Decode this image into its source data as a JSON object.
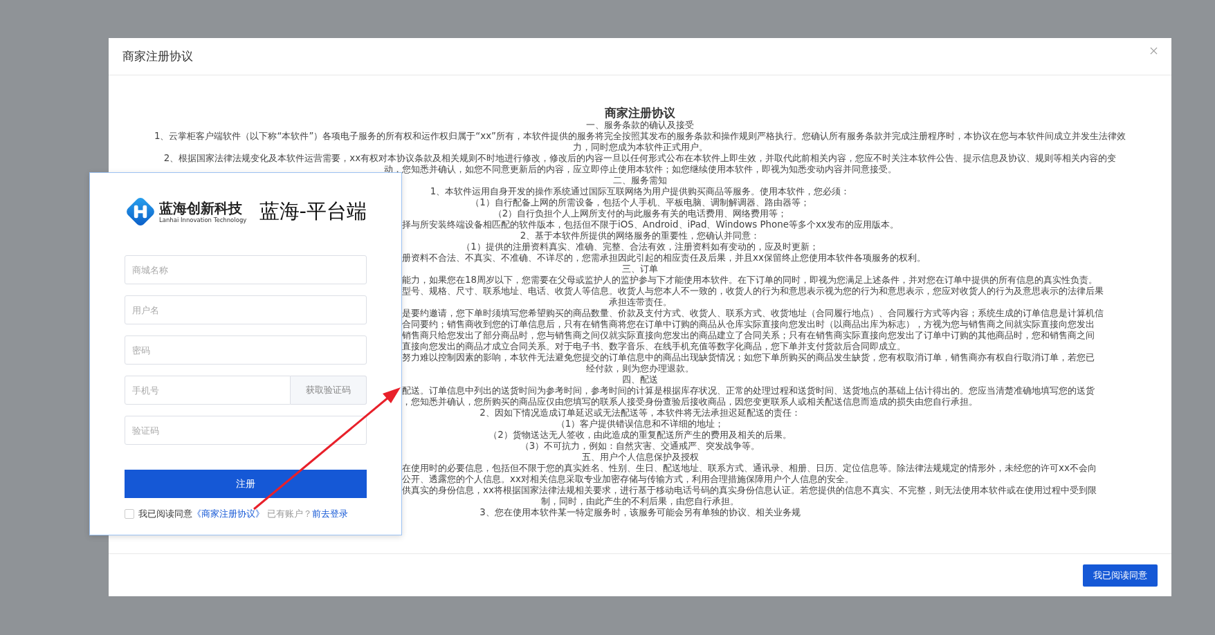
{
  "modal": {
    "title": "商家注册协议",
    "document": {
      "title": "商家注册协议",
      "lines": [
        {
          "kind": "center",
          "text": "一、服务条款的确认及接受"
        },
        {
          "kind": "center",
          "text": "1、云掌柜客户端软件（以下称“本软件”）各项电子服务的所有权和运作权归属于“xx”所有，本软件提供的服务将完全按照其发布的服务条款和操作规则严格执行。您确认所有服务条款并完成注册程序时，本协议在您与本软件间成立并发生法律效"
        },
        {
          "kind": "center",
          "text": "力，同时您成为本软件正式用户。"
        },
        {
          "kind": "center",
          "text": "2、根据国家法律法规变化及本软件运营需要，xx有权对本协议条款及相关规则不时地进行修改，修改后的内容一旦以任何形式公布在本软件上即生效，并取代此前相关内容，您应不时关注本软件公告、提示信息及协议、规则等相关内容的变"
        },
        {
          "kind": "center",
          "text": "动，您知悉并确认，如您不同意更新后的内容，应立即停止使用本软件；如您继续使用本软件，即视为知悉变动内容并同意接受。"
        },
        {
          "kind": "center",
          "text": "二、服务需知"
        },
        {
          "kind": "center",
          "text": "1、本软件运用自身开发的操作系统通过国际互联网络为用户提供购买商品等服务。使用本软件，您必须："
        },
        {
          "kind": "center",
          "text": "（1）自行配备上网的所需设备，包括个人手机、平板电脑、调制解调器、路由器等；"
        },
        {
          "kind": "center",
          "text": "（2）自行负担个人上网所支付的与此服务有关的电话费用、网络费用等；"
        },
        {
          "kind": "cut",
          "text": "择与所安装终端设备相匹配的软件版本，包括但不限于iOS、Android、iPad、Windows Phone等多个xx发布的应用版本。"
        },
        {
          "kind": "center",
          "text": "2、基于本软件所提供的网络服务的重要性，您确认并同意："
        },
        {
          "kind": "center",
          "text": "（1）提供的注册资料真实、准确、完整、合法有效，注册资料如有变动的，应及时更新；"
        },
        {
          "kind": "cut",
          "text": "册资料不合法、不真实、不准确、不详尽的，您需承担因此引起的相应责任及后果，并且xx保留终止您使用本软件各项服务的权利。"
        },
        {
          "kind": "center",
          "text": "三、订单"
        },
        {
          "kind": "cut",
          "text": "能力，如果您在18周岁以下，您需要在父母或监护人的监护参与下才能使用本软件。在下订单的同时，即视为您满足上述条件，并对您在订单中提供的所有信息的真实性负责。"
        },
        {
          "kind": "cut",
          "text": "型号、规格、尺寸、联系地址、电话、收货人等信息。收货人与您本人不一致的，收货人的行为和意思表示视为您的行为和意思表示，您应对收货人的行为及意思表示的法律后果"
        },
        {
          "kind": "center",
          "text": "承担连带责任。"
        },
        {
          "kind": "cut",
          "text": "是要约邀请，您下单时须填写您希望购买的商品数量、价款及支付方式、收货人、联系方式、收货地址（合同履行地点）、合同履行方式等内容；系统生成的订单信息是计算机信"
        },
        {
          "kind": "cut",
          "text": "合同要约；销售商收到您的订单信息后，只有在销售商将您在订单中订购的商品从仓库实际直接向您发出时（以商品出库为标志），方视为您与销售商之间就实际直接向您发出"
        },
        {
          "kind": "cut",
          "text": "销售商只给您发出了部分商品时，您与销售商之间仅就实际直接向您发出的商品建立了合同关系；只有在销售商实际直接向您发出了订单中订购的其他商品时，您和销售商之间"
        },
        {
          "kind": "cut",
          "text": "直接向您发出的商品才成立合同关系。对于电子书、数字音乐、在线手机充值等数字化商品，您下单并支付货款后合同即成立。"
        },
        {
          "kind": "cut",
          "text": "努力难以控制因素的影响，本软件无法避免您提交的订单信息中的商品出现缺货情况；如您下单所购买的商品发生缺货，您有权取消订单，销售商亦有权自行取消订单，若您已"
        },
        {
          "kind": "center",
          "text": "经付款，则为您办理退款。"
        },
        {
          "kind": "center",
          "text": "四、配送"
        },
        {
          "kind": "cut",
          "text": "配送。订单信息中列出的送货时间为参考时间，参考时间的计算是根据库存状况、正常的处理过程和送货时间、送货地点的基础上估计得出的。您应当清楚准确地填写您的送货"
        },
        {
          "kind": "cut",
          "text": "，您知悉并确认，您所购买的商品应仅由您填写的联系人接受身份查验后接收商品，因您变更联系人或相关配送信息而造成的损失由您自行承担。"
        },
        {
          "kind": "center",
          "text": "2、因如下情况造成订单延迟或无法配送等，本软件将无法承担迟延配送的责任："
        },
        {
          "kind": "center",
          "text": "（1）客户提供错误信息和不详细的地址；"
        },
        {
          "kind": "center",
          "text": "（2）货物送达无人签收，由此造成的重复配送所产生的费用及相关的后果。"
        },
        {
          "kind": "center",
          "text": "（3）不可抗力，例如：自然灾害、交通戒严、突发战争等。"
        },
        {
          "kind": "center",
          "text": "五、用户个人信息保护及授权"
        },
        {
          "kind": "cut",
          "text": "在使用时的必要信息，包括但不限于您的真实姓名、性别、生日、配送地址、联系方式、通讯录、相册、日历、定位信息等。除法律法规规定的情形外，未经您的许可xx不会向"
        },
        {
          "kind": "cut",
          "text": "公开、透露您的个人信息。xx对相关信息采取专业加密存储与传输方式，利用合理措施保障用户个人信息的安全。"
        },
        {
          "kind": "cut",
          "text": "供真实的身份信息，xx将根据国家法律法规相关要求，进行基于移动电话号码的真实身份信息认证。若您提供的信息不真实、不完整，则无法使用本软件或在使用过程中受到限"
        },
        {
          "kind": "center",
          "text": "制，同时，由此产生的不利后果，由您自行承担。"
        },
        {
          "kind": "center",
          "text": "3、您在使用本软件某一特定服务时，该服务可能会另有单独的协议、相关业务规"
        }
      ]
    },
    "confirm_button": "我已阅读同意"
  },
  "register_card": {
    "brand_name": "蓝海创新科技",
    "brand_tagline": "Lanhai Innovation Technology",
    "platform_title": "蓝海-平台端",
    "fields": [
      {
        "placeholder": "商城名称"
      },
      {
        "placeholder": "用户名"
      },
      {
        "placeholder": "密码"
      },
      {
        "placeholder": "手机号",
        "action": "获取验证码"
      },
      {
        "placeholder": "验证码"
      }
    ],
    "submit": "注册",
    "agree": {
      "checked": false,
      "label": "我已阅读同意",
      "link": "《商家注册协议》"
    },
    "login_prompt": "已有账户？",
    "login_link": "前去登录"
  }
}
